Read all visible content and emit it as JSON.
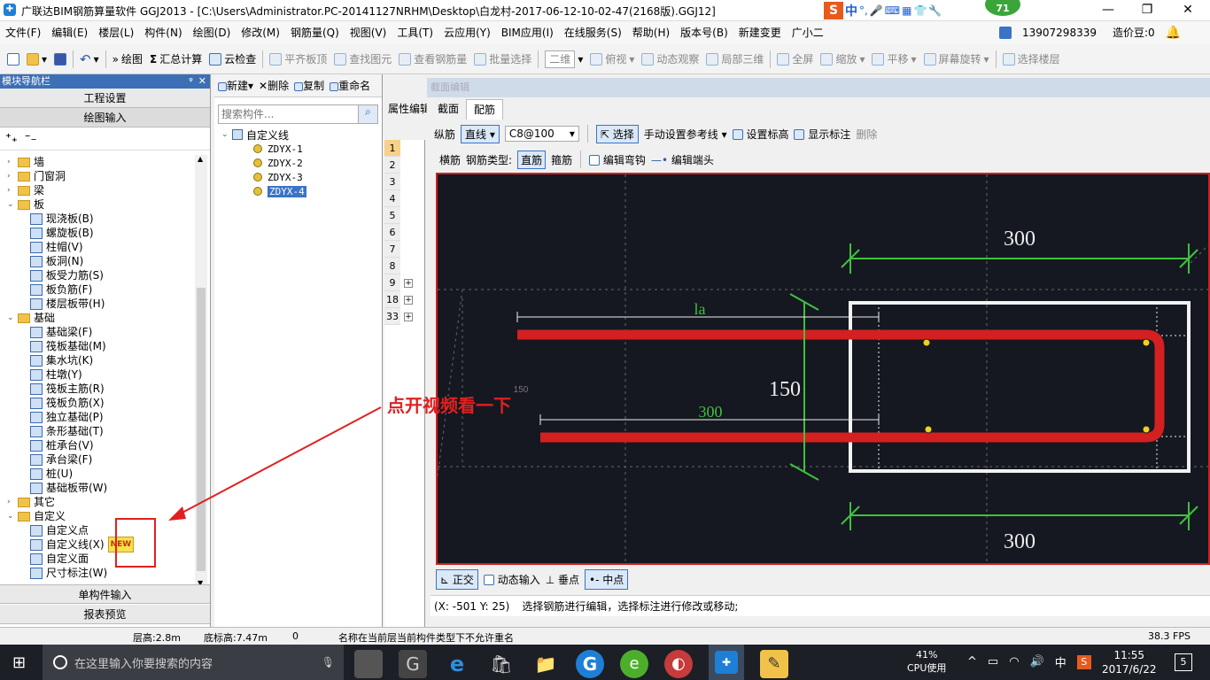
{
  "title": {
    "text": "广联达BIM钢筋算量软件 GGJ2013 - [C:\\Users\\Administrator.PC-20141127NRHM\\Desktop\\白龙村-2017-06-12-10-02-47(2168版).GGJ12]",
    "badge": "71"
  },
  "menu": [
    "文件(F)",
    "编辑(E)",
    "楼层(L)",
    "构件(N)",
    "绘图(D)",
    "修改(M)",
    "钢筋量(Q)",
    "视图(V)",
    "工具(T)",
    "云应用(Y)",
    "BIM应用(I)",
    "在线服务(S)",
    "帮助(H)",
    "版本号(B)",
    "新建变更",
    "广小二"
  ],
  "menu_right": {
    "phone": "13907298339",
    "price": "造价豆:0"
  },
  "toolbar": {
    "draw": "绘图",
    "sum": "汇总计算",
    "cloud": "云检查",
    "flat": "平齐板顶",
    "find": "查找图元",
    "view_steel": "查看钢筋量",
    "batch": "批量选择",
    "mode": "二维",
    "top": "俯视",
    "dynamic": "动态观察",
    "local3d": "局部三维",
    "full": "全屏",
    "zoom": "缩放",
    "pan": "平移",
    "rotate": "屏幕旋转",
    "floor": "选择楼层"
  },
  "nav": {
    "header": "模块导航栏",
    "project": "工程设置",
    "draw_input": "绘图输入",
    "single_input": "单构件输入",
    "report": "报表预览",
    "tree": [
      {
        "label": "墙",
        "level": 0,
        "type": "folder",
        "tog": "›"
      },
      {
        "label": "门窗洞",
        "level": 0,
        "type": "folder",
        "tog": "›"
      },
      {
        "label": "梁",
        "level": 0,
        "type": "folder",
        "tog": "›"
      },
      {
        "label": "板",
        "level": 0,
        "type": "folder",
        "tog": "⌄"
      },
      {
        "label": "现浇板(B)",
        "level": 1,
        "type": "item"
      },
      {
        "label": "螺旋板(B)",
        "level": 1,
        "type": "item"
      },
      {
        "label": "柱帽(V)",
        "level": 1,
        "type": "item"
      },
      {
        "label": "板洞(N)",
        "level": 1,
        "type": "item"
      },
      {
        "label": "板受力筋(S)",
        "level": 1,
        "type": "item"
      },
      {
        "label": "板负筋(F)",
        "level": 1,
        "type": "item"
      },
      {
        "label": "楼层板带(H)",
        "level": 1,
        "type": "item"
      },
      {
        "label": "基础",
        "level": 0,
        "type": "folder",
        "tog": "⌄"
      },
      {
        "label": "基础梁(F)",
        "level": 1,
        "type": "item"
      },
      {
        "label": "筏板基础(M)",
        "level": 1,
        "type": "item"
      },
      {
        "label": "集水坑(K)",
        "level": 1,
        "type": "item"
      },
      {
        "label": "柱墩(Y)",
        "level": 1,
        "type": "item"
      },
      {
        "label": "筏板主筋(R)",
        "level": 1,
        "type": "item"
      },
      {
        "label": "筏板负筋(X)",
        "level": 1,
        "type": "item"
      },
      {
        "label": "独立基础(P)",
        "level": 1,
        "type": "item"
      },
      {
        "label": "条形基础(T)",
        "level": 1,
        "type": "item"
      },
      {
        "label": "桩承台(V)",
        "level": 1,
        "type": "item"
      },
      {
        "label": "承台梁(F)",
        "level": 1,
        "type": "item"
      },
      {
        "label": "桩(U)",
        "level": 1,
        "type": "item"
      },
      {
        "label": "基础板带(W)",
        "level": 1,
        "type": "item"
      },
      {
        "label": "其它",
        "level": 0,
        "type": "folder",
        "tog": "›"
      },
      {
        "label": "自定义",
        "level": 0,
        "type": "folder",
        "tog": "⌄"
      },
      {
        "label": "自定义点",
        "level": 1,
        "type": "item"
      },
      {
        "label": "自定义线(X)",
        "level": 1,
        "type": "item"
      },
      {
        "label": "自定义面",
        "level": 1,
        "type": "item"
      },
      {
        "label": "尺寸标注(W)",
        "level": 1,
        "type": "item"
      }
    ],
    "new_badge": "NEW"
  },
  "list": {
    "new": "新建",
    "delete": "删除",
    "copy": "复制",
    "rename": "重命名",
    "search_placeholder": "搜索构件...",
    "root": "自定义线",
    "items": [
      "ZDYX-1",
      "ZDYX-2",
      "ZDYX-3",
      "ZDYX-4"
    ],
    "selected": "ZDYX-4"
  },
  "attr": {
    "header": "属性编辑",
    "rows": [
      "1",
      "2",
      "3",
      "4",
      "5",
      "6",
      "7",
      "8",
      "9",
      "18",
      "33"
    ]
  },
  "editor": {
    "title": "截面编辑",
    "tabs": [
      "截面",
      "配筋"
    ],
    "active_tab": "配筋",
    "long_label": "纵筋",
    "line_mode": "直线",
    "spec": "C8@100",
    "select": "选择",
    "manual_ref": "手动设置参考线",
    "set_elev": "设置标高",
    "show_anno": "显示标注",
    "delete": "删除",
    "trans_label": "横筋",
    "steel_type": "钢筋类型:",
    "straight": "直筋",
    "stirrup": "箍筋",
    "edit_hook": "编辑弯钩",
    "edit_end": "编辑端头",
    "bottom": [
      "正交",
      "动态输入",
      "垂点",
      "中点"
    ],
    "coord": "(X: -501 Y: 25)",
    "hint": "选择钢筋进行编辑，选择标注进行修改或移动;"
  },
  "canvas": {
    "dim_top": "300",
    "dim_bottom": "300",
    "dim_height": "150",
    "label_la": "la",
    "label_300": "300",
    "label_150_small": "150"
  },
  "annotation": {
    "text": "点开视频看一下"
  },
  "status": {
    "floor_h": "层高:2.8m",
    "base_h": "底标高:7.47m",
    "zero": "0",
    "msg": "名称在当前层当前构件类型下不允许重名",
    "fps": "38.3 FPS"
  },
  "taskbar": {
    "search": "在这里输入你要搜索的内容",
    "cpu_pct": "41%",
    "cpu_label": "CPU使用",
    "time": "11:55",
    "date": "2017/6/22",
    "lang": "中",
    "notif": "5"
  },
  "colors": {
    "rebar": "#d42020",
    "dim": "#3fc13f",
    "canvas_bg": "#151820",
    "frame": "#f2f2f2",
    "node": "#f0d020",
    "accent": "#3a73c8"
  }
}
